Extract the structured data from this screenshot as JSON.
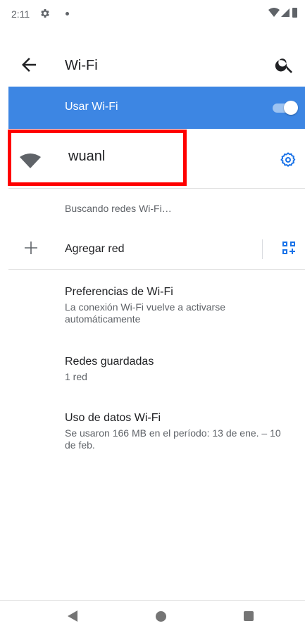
{
  "status_bar": {
    "time": "2:11",
    "icons_left": [
      "settings-gear",
      "notification-dot"
    ],
    "icons_right": [
      "wifi-signal",
      "cell-signal",
      "battery"
    ]
  },
  "app_bar": {
    "title": "Wi-Fi",
    "back_icon": "arrow-left",
    "search_icon": "search"
  },
  "use_wifi": {
    "label": "Usar Wi-Fi",
    "enabled": true,
    "bar_color": "#3d86e3"
  },
  "connected_network": {
    "name": "wuanl",
    "icon": "wifi-full",
    "settings_icon": "gear",
    "highlight_color": "#ff0000",
    "accent_color": "#1a73e8"
  },
  "scan_status": "Buscando redes Wi-Fi…",
  "add_network": {
    "label": "Agregar red",
    "icon": "plus",
    "qr_icon": "qr-code-scanner"
  },
  "preferences": [
    {
      "title": "Preferencias de Wi-Fi",
      "summary": "La conexión Wi-Fi vuelve a activarse automáticamente"
    },
    {
      "title": "Redes guardadas",
      "summary": "1 red"
    },
    {
      "title": "Uso de datos Wi-Fi",
      "summary": "Se usaron 166 MB en el período: 13 de ene. – 10 de feb."
    }
  ],
  "nav_bar": {
    "buttons": [
      "back-triangle",
      "home-circle",
      "recents-square"
    ]
  }
}
